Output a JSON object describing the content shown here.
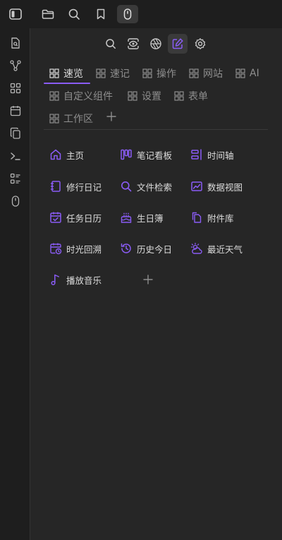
{
  "tabs": [
    {
      "label": "速览",
      "active": true
    },
    {
      "label": "速记"
    },
    {
      "label": "操作"
    },
    {
      "label": "网站"
    },
    {
      "label": "AI"
    },
    {
      "label": "自定义组件"
    },
    {
      "label": "设置"
    },
    {
      "label": "表单"
    },
    {
      "label": "工作区"
    }
  ],
  "widgets": [
    {
      "label": "主页",
      "icon": "home-icon"
    },
    {
      "label": "笔记看板",
      "icon": "kanban-icon"
    },
    {
      "label": "时间轴",
      "icon": "timeline-icon"
    },
    {
      "label": "修行日记",
      "icon": "notebook-icon"
    },
    {
      "label": "文件检索",
      "icon": "search-icon"
    },
    {
      "label": "数据视图",
      "icon": "chart-icon"
    },
    {
      "label": "任务日历",
      "icon": "calendar-check-icon"
    },
    {
      "label": "生日簿",
      "icon": "cake-icon"
    },
    {
      "label": "附件库",
      "icon": "files-icon"
    },
    {
      "label": "时光回溯",
      "icon": "calendar-clock-icon"
    },
    {
      "label": "历史今日",
      "icon": "history-icon"
    },
    {
      "label": "最近天气",
      "icon": "weather-icon"
    },
    {
      "label": "播放音乐",
      "icon": "music-icon"
    }
  ],
  "colors": {
    "accent": "#8a5cf5",
    "icon_gray": "#b5b5b5",
    "muted": "#8e8e8e"
  }
}
